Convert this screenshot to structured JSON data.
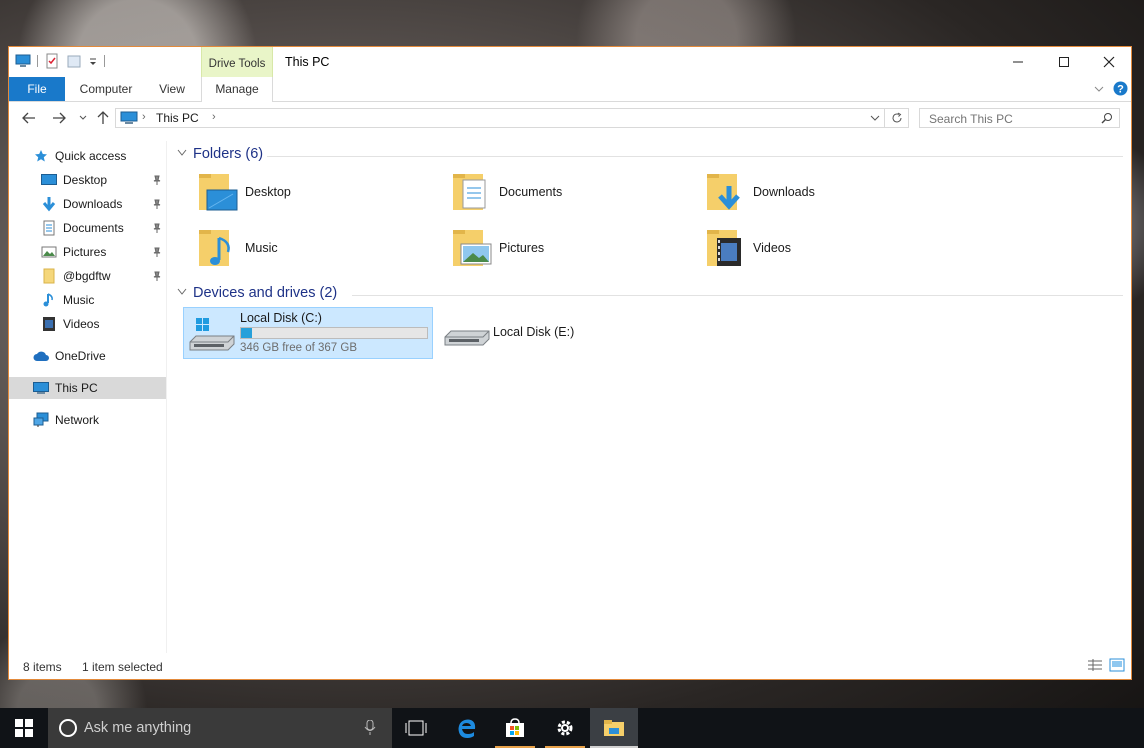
{
  "window": {
    "title": "This PC",
    "context_tab_group": "Drive Tools",
    "ribbon_tabs": [
      "File",
      "Computer",
      "View",
      "Manage"
    ]
  },
  "nav": {
    "breadcrumb": [
      "This PC"
    ],
    "search_placeholder": "Search This PC"
  },
  "sidebar": {
    "items": [
      {
        "label": "Quick access",
        "icon": "star-icon"
      },
      {
        "label": "Desktop",
        "icon": "desktop-icon",
        "pinned": true
      },
      {
        "label": "Downloads",
        "icon": "download-icon",
        "pinned": true
      },
      {
        "label": "Documents",
        "icon": "documents-icon",
        "pinned": true
      },
      {
        "label": "Pictures",
        "icon": "pictures-icon",
        "pinned": true
      },
      {
        "label": "@bgdftw",
        "icon": "folder-icon",
        "pinned": true
      },
      {
        "label": "Music",
        "icon": "music-icon"
      },
      {
        "label": "Videos",
        "icon": "videos-icon"
      },
      {
        "label": "OneDrive",
        "icon": "cloud-icon"
      },
      {
        "label": "This PC",
        "icon": "computer-icon",
        "selected": true
      },
      {
        "label": "Network",
        "icon": "network-icon"
      }
    ]
  },
  "folders": {
    "header": "Folders (6)",
    "items": [
      {
        "label": "Desktop",
        "icon": "desktop-folder-icon"
      },
      {
        "label": "Documents",
        "icon": "documents-folder-icon"
      },
      {
        "label": "Downloads",
        "icon": "downloads-folder-icon"
      },
      {
        "label": "Music",
        "icon": "music-folder-icon"
      },
      {
        "label": "Pictures",
        "icon": "pictures-folder-icon"
      },
      {
        "label": "Videos",
        "icon": "videos-folder-icon"
      }
    ]
  },
  "drives": {
    "header": "Devices and drives (2)",
    "items": [
      {
        "label": "Local Disk (C:)",
        "free_text": "346 GB free of 367 GB",
        "used_fraction": 0.057,
        "selected": true,
        "icon": "system-drive-icon"
      },
      {
        "label": "Local Disk (E:)",
        "icon": "drive-icon"
      }
    ]
  },
  "status": {
    "count": "8 items",
    "selection": "1 item selected"
  },
  "taskbar": {
    "search_text": "Ask me anything"
  },
  "colors": {
    "accent": "#1979ca",
    "window_border": "#e38a3b",
    "selection": "#cce8ff",
    "drive_fill": "#26a0da",
    "context_tab": "#e9f5c8",
    "taskbar": "#101317"
  }
}
